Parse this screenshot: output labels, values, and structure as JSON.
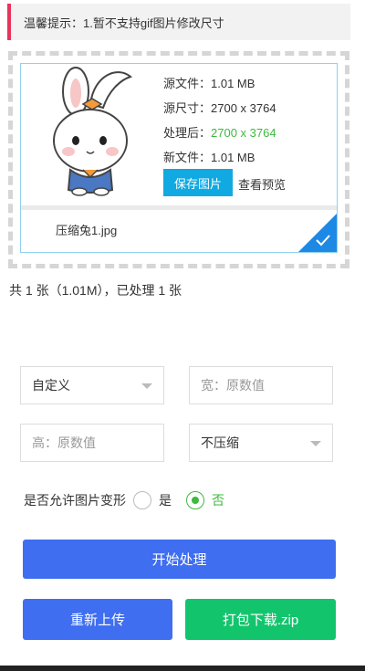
{
  "tip": {
    "text": "温馨提示：1.暂不支持gif图片修改尺寸",
    "accent": "#e8335a"
  },
  "file": {
    "source_size_label": "源文件：1.01 MB",
    "source_dim_label": "源尺寸：",
    "source_dim_value": "2700 x 3764",
    "processed_label": "处理后：",
    "processed_value": "2700 x 3764",
    "new_size_label": "新文件：1.01 MB",
    "save_button": "保存图片",
    "preview_link": "查看预览",
    "name": "压缩兔1.jpg",
    "thumbnail_icon": "rabbit-thumbnail",
    "selected_icon": "check-icon"
  },
  "summary": "共 1 张（1.01M），已处理 1 张",
  "form": {
    "preset_select": "自定义",
    "width_placeholder": "宽：原数值",
    "height_placeholder": "高：原数值",
    "compress_select": "不压缩",
    "deform_label": "是否允许图片变形",
    "option_yes": "是",
    "option_no": "否"
  },
  "buttons": {
    "start": "开始处理",
    "reupload": "重新上传",
    "download_zip": "打包下载.zip"
  },
  "colors": {
    "primary": "#3f6ef0",
    "success": "#12c56d",
    "info": "#10a9e2",
    "green_text": "#3dba3d"
  }
}
